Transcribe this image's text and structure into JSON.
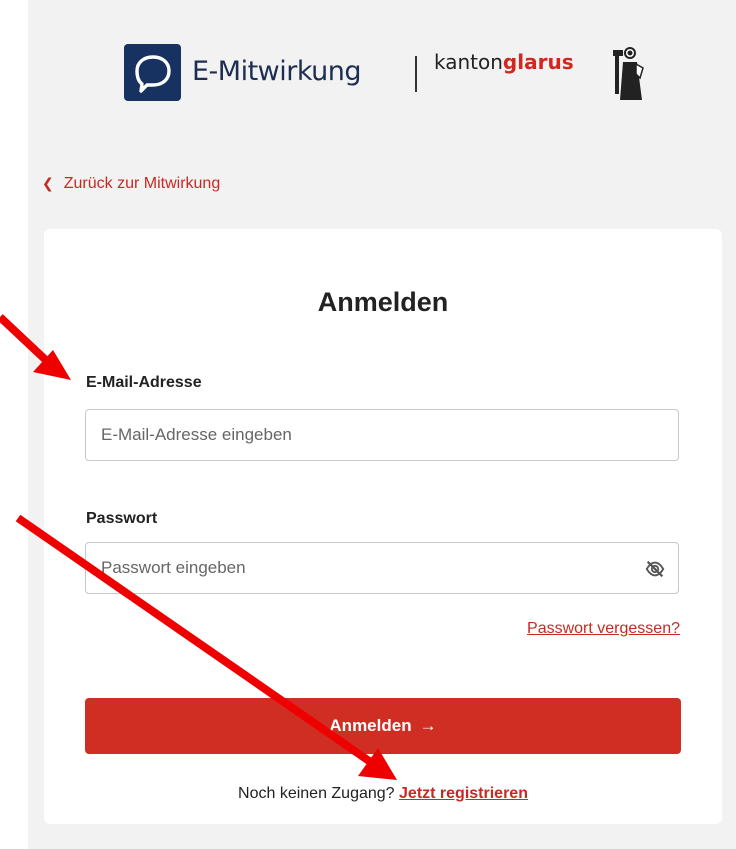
{
  "header": {
    "brand": "E-Mitwirkung",
    "kanton_prefix": "kanton",
    "kanton_name": "glarus"
  },
  "back_link": "Zurück zur Mitwirkung",
  "form": {
    "title": "Anmelden",
    "email_label": "E-Mail-Adresse",
    "email_placeholder": "E-Mail-Adresse eingeben",
    "password_label": "Passwort",
    "password_placeholder": "Passwort eingeben",
    "forgot_link": "Passwort vergessen?",
    "submit_label": "Anmelden",
    "no_account_text": "Noch keinen Zugang?",
    "register_link": "Jetzt registrieren"
  },
  "colors": {
    "brand_blue": "#173261",
    "accent_red": "#d12e23",
    "annotation_red": "#ee0000",
    "page_bg": "#f2f2f2"
  },
  "icons": {
    "logo": "speech-bubble-logo-icon",
    "back": "chevron-left-icon",
    "password_toggle": "eye-slash-icon",
    "submit": "arrow-right-icon"
  }
}
